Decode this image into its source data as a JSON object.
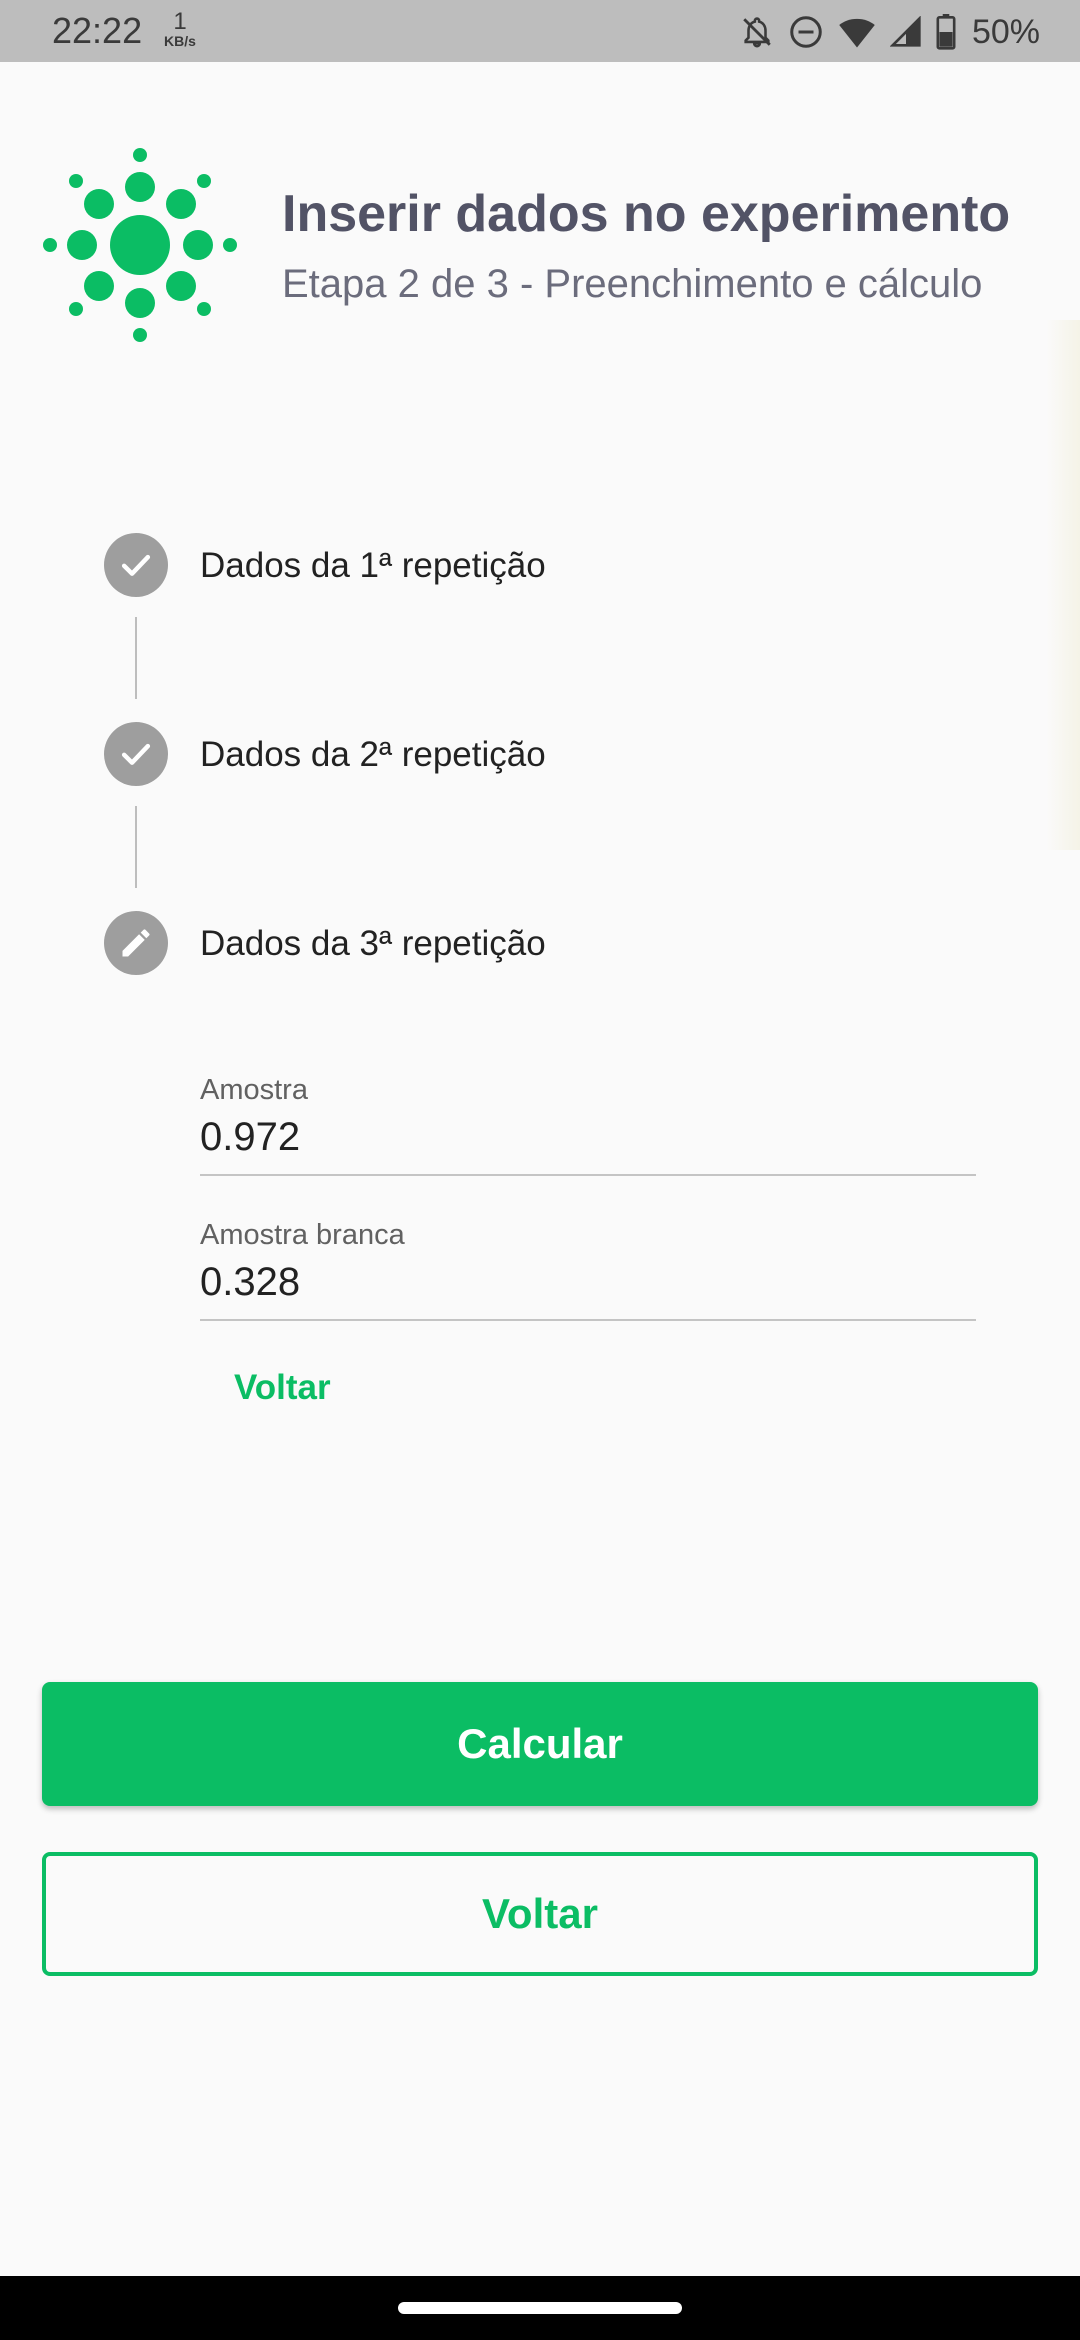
{
  "status_bar": {
    "time": "22:22",
    "speed_value": "1",
    "speed_unit": "KB/s",
    "battery_percent": "50%",
    "icons": [
      "notifications-off-icon",
      "do-not-disturb-icon",
      "wifi-icon",
      "signal-icon",
      "battery-icon"
    ]
  },
  "header": {
    "title": "Inserir dados no experimento",
    "subtitle": "Etapa 2 de 3 - Preenchimento e cálculo",
    "logo_icon": "sun-dots-logo"
  },
  "steps": [
    {
      "label": "Dados da 1ª repetição",
      "state": "done",
      "icon": "check-icon"
    },
    {
      "label": "Dados da 2ª repetição",
      "state": "done",
      "icon": "check-icon"
    },
    {
      "label": "Dados da 3ª repetição",
      "state": "editing",
      "icon": "pencil-icon"
    }
  ],
  "form": {
    "fields": [
      {
        "label": "Amostra",
        "value": "0.972"
      },
      {
        "label": "Amostra branca",
        "value": "0.328"
      }
    ],
    "step_back_label": "Voltar"
  },
  "actions": {
    "calculate_label": "Calcular",
    "back_label": "Voltar"
  },
  "colors": {
    "accent": "#0bbd64",
    "title": "#525366",
    "step_circle": "#9e9e9e",
    "status_bar": "#bdbdbd"
  }
}
